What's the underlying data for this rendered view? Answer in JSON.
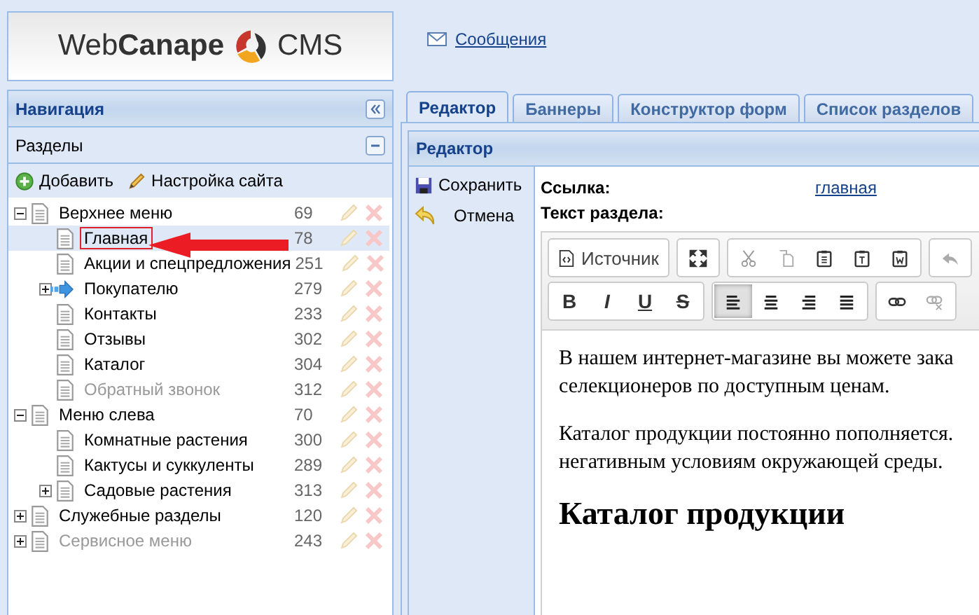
{
  "logo": {
    "text_light": "Web",
    "text_bold": "Canape",
    "text_suffix": "CMS"
  },
  "messages_link": "Сообщения",
  "navigation": {
    "title": "Навигация",
    "section": "Разделы",
    "actions": [
      {
        "kind": "add",
        "label": "Добавить"
      },
      {
        "kind": "settings",
        "label": "Настройка сайта"
      }
    ],
    "tree": [
      {
        "label": "Верхнее меню",
        "count": "69",
        "expanded": true,
        "disabled": false,
        "selected": false,
        "kind": "page",
        "children": [
          {
            "label": "Главная",
            "count": "78",
            "disabled": false,
            "selected": true,
            "kind": "page"
          },
          {
            "label": "Акции и спецпредложения",
            "count": "251",
            "disabled": false,
            "selected": false,
            "kind": "page"
          },
          {
            "label": "Покупателю",
            "count": "279",
            "expanded": false,
            "disabled": false,
            "selected": false,
            "kind": "redirect"
          },
          {
            "label": "Контакты",
            "count": "233",
            "disabled": false,
            "selected": false,
            "kind": "page"
          },
          {
            "label": "Отзывы",
            "count": "302",
            "disabled": false,
            "selected": false,
            "kind": "page"
          },
          {
            "label": "Каталог",
            "count": "304",
            "disabled": false,
            "selected": false,
            "kind": "page"
          },
          {
            "label": "Обратный звонок",
            "count": "312",
            "disabled": true,
            "selected": false,
            "kind": "page"
          }
        ]
      },
      {
        "label": "Меню слева",
        "count": "70",
        "expanded": true,
        "disabled": false,
        "selected": false,
        "kind": "page",
        "children": [
          {
            "label": "Комнатные растения",
            "count": "300",
            "disabled": false,
            "selected": false,
            "kind": "page"
          },
          {
            "label": "Кактусы и суккуленты",
            "count": "289",
            "disabled": false,
            "selected": false,
            "kind": "page"
          },
          {
            "label": "Садовые растения",
            "count": "313",
            "expanded": false,
            "disabled": false,
            "selected": false,
            "kind": "page"
          }
        ]
      },
      {
        "label": "Служебные разделы",
        "count": "120",
        "expanded": false,
        "disabled": false,
        "selected": false,
        "kind": "page"
      },
      {
        "label": "Сервисное меню",
        "count": "243",
        "expanded": false,
        "disabled": true,
        "selected": false,
        "kind": "page"
      }
    ]
  },
  "tabs": [
    {
      "label": "Редактор",
      "selected": true
    },
    {
      "label": "Баннеры",
      "selected": false
    },
    {
      "label": "Конструктор форм",
      "selected": false
    },
    {
      "label": "Список разделов",
      "selected": false
    }
  ],
  "editor": {
    "title": "Редактор",
    "actions": [
      {
        "kind": "save",
        "label": "Сохранить"
      },
      {
        "kind": "cancel",
        "label": "Отмена"
      }
    ],
    "link_label": "Ссылка:",
    "link_value": "главная",
    "text_label": "Текст раздела:",
    "toolbar": {
      "source_label": "Источник",
      "format_buttons": [
        {
          "kind": "bold",
          "label": "B"
        },
        {
          "kind": "italic",
          "label": "I"
        },
        {
          "kind": "underline",
          "label": "U"
        },
        {
          "kind": "strike",
          "label": "S"
        }
      ],
      "align_buttons": [
        {
          "selected": true
        },
        {
          "selected": false
        },
        {
          "selected": false
        },
        {
          "selected": false
        }
      ]
    },
    "content": [
      {
        "kind": "p",
        "lines": [
          "В нашем интернет-магазине вы можете зака",
          "селекционеров по доступным ценам."
        ]
      },
      {
        "kind": "p",
        "lines": [
          "Каталог продукции постоянно пополняется.",
          "негативным условиям окружающей среды."
        ]
      },
      {
        "kind": "h2",
        "lines": [
          "Каталог продукции"
        ]
      }
    ]
  }
}
